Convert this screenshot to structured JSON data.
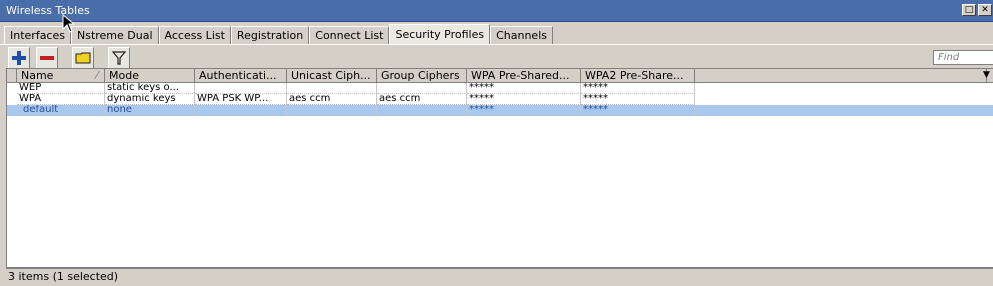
{
  "window": {
    "title": "Wireless Tables"
  },
  "tabs": [
    {
      "label": "Interfaces"
    },
    {
      "label": "Nstreme Dual"
    },
    {
      "label": "Access List"
    },
    {
      "label": "Registration"
    },
    {
      "label": "Connect List"
    },
    {
      "label": "Security Profiles",
      "active": true
    },
    {
      "label": "Channels"
    }
  ],
  "toolbar": {
    "add_icon": "plus-icon",
    "remove_icon": "minus-icon",
    "comment_icon": "comment-icon",
    "filter_icon": "filter-icon",
    "find_placeholder": "Find"
  },
  "table": {
    "columns": [
      "Name",
      "Mode",
      "Authenticati...",
      "Unicast Ciph...",
      "Group Ciphers",
      "WPA Pre-Shared...",
      "WPA2 Pre-Share..."
    ],
    "rows": [
      [
        "WEP",
        "static keys o...",
        "",
        "",
        "",
        "*****",
        "*****"
      ],
      [
        "WPA",
        "dynamic keys",
        "WPA PSK WP...",
        "aes ccm",
        "aes ccm",
        "*****",
        "*****"
      ],
      [
        "default",
        "none",
        "",
        "",
        "",
        "*****",
        "*****"
      ]
    ],
    "selected_row": 2
  },
  "status": {
    "text": "3 items (1 selected)"
  },
  "colors": {
    "titlebar": "#4a6ea9",
    "selection": "#a8c8f0",
    "add": "#1e4ea8",
    "remove": "#c02020",
    "comment": "#f0d020"
  }
}
